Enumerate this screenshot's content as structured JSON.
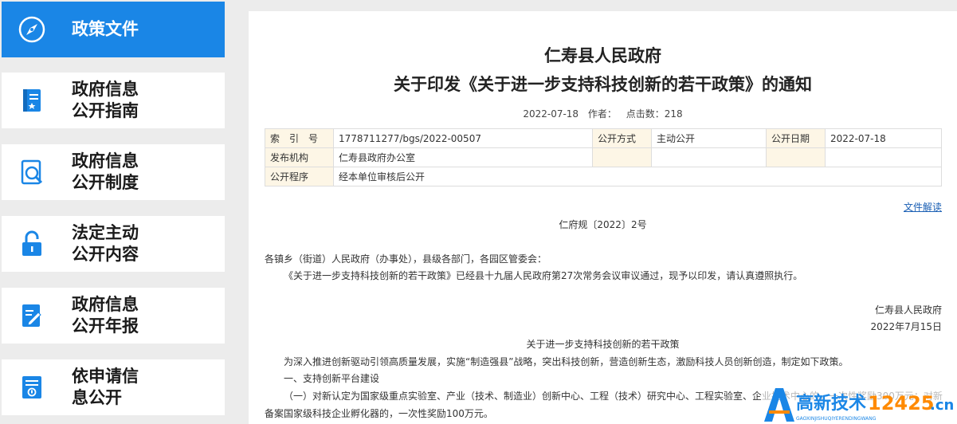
{
  "sidebar": {
    "items": [
      {
        "label": "政策文件",
        "icon": "compass-icon",
        "active": true
      },
      {
        "label": "政府信息\n公开指南",
        "icon": "book-icon"
      },
      {
        "label": "政府信息\n公开制度",
        "icon": "magnifier-doc-icon"
      },
      {
        "label": "法定主动\n公开内容",
        "icon": "lock-icon"
      },
      {
        "label": "政府信息\n公开年报",
        "icon": "edit-doc-icon"
      },
      {
        "label": "依申请信\n息公开",
        "icon": "form-doc-icon"
      }
    ]
  },
  "article": {
    "title_line1": "仁寿县人民政府",
    "title_line2": "关于印发《关于进一步支持科技创新的若干政策》的通知",
    "date": "2022-07-18",
    "author_label": "作者：",
    "clicks": "点击数：218",
    "info_table": {
      "index_label": "索　引　号",
      "index_value": "1778711277/bgs/2022-00507",
      "public_mode_label": "公开方式",
      "public_mode_value": "主动公开",
      "public_date_label": "公开日期",
      "public_date_value": "2022-07-18",
      "agency_label": "发布机构",
      "agency_value": "仁寿县政府办公室",
      "procedure_label": "公开程序",
      "procedure_value": "经本单位审核后公开"
    },
    "interpretation_link": "文件解读",
    "doc_number": "仁府规〔2022〕2号",
    "recipients": "各镇乡（街道）人民政府（办事处），县级各部门，各园区管委会：",
    "body_intro": "《关于进一步支持科技创新的若干政策》已经县十九届人民政府第27次常务会议审议通过，现予以印发，请认真遵照执行。",
    "signer": "仁寿县人民政府",
    "sign_date": "2022年7月15日",
    "policy_title": "关于进一步支持科技创新的若干政策",
    "policy_intro": "为深入推进创新驱动引领高质量发展，实施“制造强县”战略，突出科技创新，营造创新生态，激励科技人员创新创造，制定如下政策。",
    "section1": "一、支持创新平台建设",
    "item1_line1": "（一）对新认定为国家级重点实验室、产业（技术、制造业）创新中心、工程（技术）研究中心、工程实验室、企业技术中心的，一次性奖励300万元；对新",
    "item1_line2": "备案国家级科技企业孵化器的，一次性奖励100万元。"
  },
  "watermark": {
    "brand": "高新技术",
    "domain_num": "12425",
    "domain_suffix": ".cn",
    "pinyin": "GAOXINJISHUQIYERENDINGWANG"
  }
}
